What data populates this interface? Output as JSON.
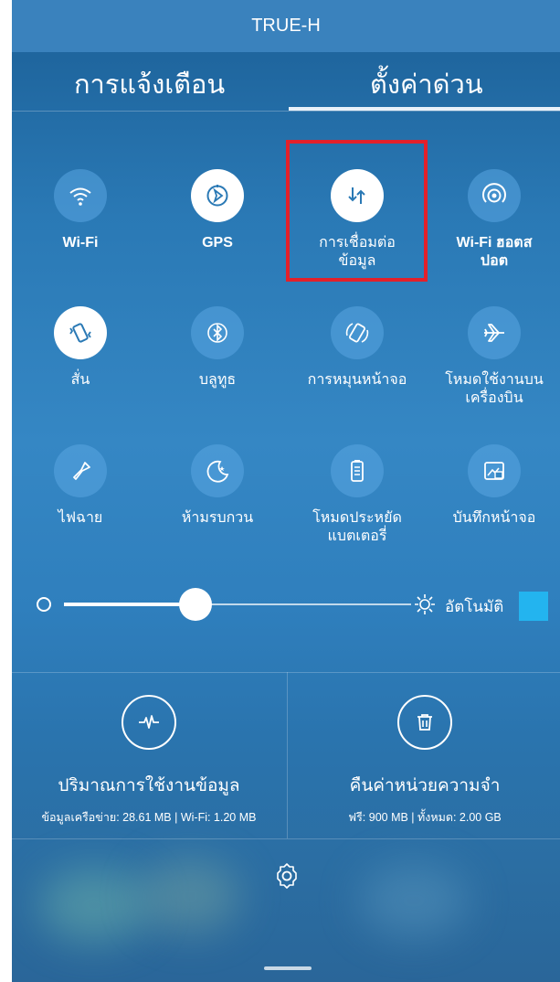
{
  "status_bar": {
    "carrier": "TRUE-H"
  },
  "tabs": [
    {
      "label": "การแจ้งเตือน",
      "selected": false
    },
    {
      "label": "ตั้งค่าด่วน",
      "selected": true
    }
  ],
  "tiles": [
    {
      "label": "Wi-Fi",
      "icon": "wifi-icon",
      "state": "off"
    },
    {
      "label": "GPS",
      "icon": "gps-icon",
      "state": "on"
    },
    {
      "label": "การเชื่อมต่อข้อมูล",
      "icon": "mobile-data-icon",
      "state": "on"
    },
    {
      "label": "Wi-Fi ฮอตสปอต",
      "icon": "hotspot-icon",
      "state": "off"
    },
    {
      "label": "สั่น",
      "icon": "vibrate-icon",
      "state": "on"
    },
    {
      "label": "บลูทูธ",
      "icon": "bluetooth-icon",
      "state": "off"
    },
    {
      "label": "การหมุนหน้าจอ",
      "icon": "rotate-icon",
      "state": "off"
    },
    {
      "label": "โหมดใช้งานบนเครื่องบิน",
      "icon": "airplane-icon",
      "state": "off"
    },
    {
      "label": "ไฟฉาย",
      "icon": "flashlight-icon",
      "state": "off"
    },
    {
      "label": "ห้ามรบกวน",
      "icon": "moon-icon",
      "state": "off"
    },
    {
      "label": "โหมดประหยัดแบตเตอรี่",
      "icon": "battery-icon",
      "state": "off"
    },
    {
      "label": "บันทึกหน้าจอ",
      "icon": "screenshot-icon",
      "state": "off"
    }
  ],
  "brightness": {
    "level": 0.38,
    "auto_label": "อัตโนมัติ",
    "auto_checked": true
  },
  "data_usage": {
    "title": "ปริมาณการใช้งานข้อมูล",
    "detail": "ข้อมูลเครือข่าย: 28.61 MB  |  Wi-Fi: 1.20 MB",
    "icon": "pulse-icon"
  },
  "memory": {
    "title": "คืนค่าหน่วยความจำ",
    "detail": "ฟรี: 900 MB  |  ทั้งหมด: 2.00 GB",
    "icon": "trash-icon"
  },
  "colors": {
    "accent": "#23b4ef",
    "highlight": "#e3202a"
  }
}
